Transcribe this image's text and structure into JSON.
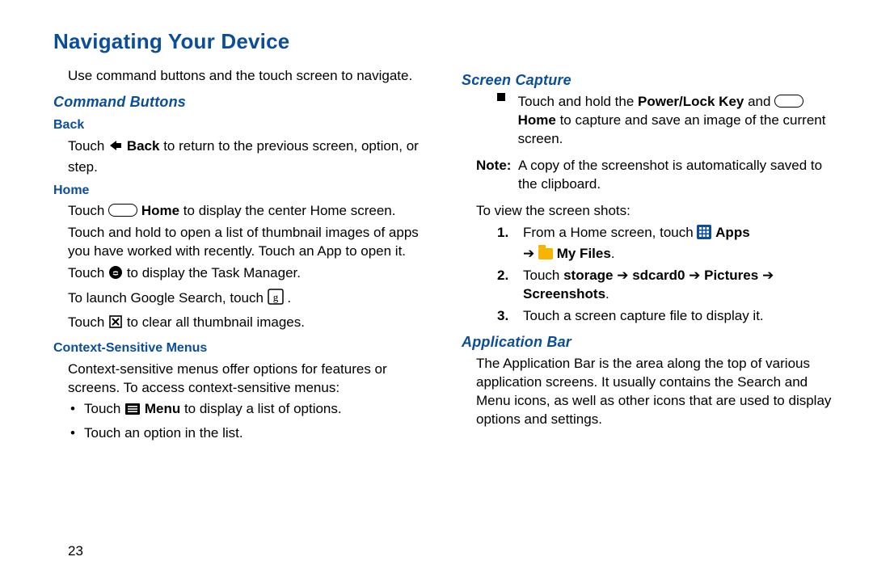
{
  "page_number": "23",
  "title": "Navigating Your Device",
  "intro": "Use command buttons and the touch screen to navigate.",
  "left": {
    "command_buttons": "Command Buttons",
    "back_h": "Back",
    "back_p1a": "Touch ",
    "back_label": "Back",
    "back_p1b": " to return to the previous screen, option, or step.",
    "home_h": "Home",
    "home_p1a": "Touch ",
    "home_label": "Home",
    "home_p1b": " to display the center Home screen.",
    "home_p2": "Touch and hold to open a list of thumbnail images of apps you have worked with recently. Touch an App to open it.",
    "home_p3a": "Touch ",
    "home_p3b": " to display the Task Manager.",
    "home_p4a": "To launch Google Search, touch ",
    "home_p4b": ".",
    "home_p5a": "Touch ",
    "home_p5b": " to clear all thumbnail images.",
    "ctx_h": "Context-Sensitive Menus",
    "ctx_p": "Context-sensitive menus offer options for features or screens. To access context-sensitive menus:",
    "ctx_b1a": "Touch ",
    "ctx_menu_label": "Menu",
    "ctx_b1b": " to display a list of options.",
    "ctx_b2": "Touch an option in the list."
  },
  "right": {
    "screen_capture_h": "Screen Capture",
    "sc_bullet_a": "Touch and hold the ",
    "sc_power": "Power/Lock Key",
    "sc_and": " and ",
    "sc_home": "Home",
    "sc_bullet_b": " to capture and save an image of the current screen.",
    "note_lbl": "Note:",
    "note_body": "A copy of the screenshot is automatically saved to the clipboard.",
    "view_intro": "To view the screen shots:",
    "s1a": "From a Home screen, touch ",
    "s1_apps": "Apps",
    "s1_arrow": "➔",
    "s1_myfiles": "My Files",
    "s1_end": ".",
    "s2a": "Touch ",
    "s2_storage": "storage",
    "s2_arrow": " ➔ ",
    "s2_sd": "sdcard0",
    "s2_pics": "Pictures",
    "s2_ss": "Screenshots",
    "s2_end": ".",
    "s3": "Touch a screen capture file to display it.",
    "appbar_h": "Application Bar",
    "appbar_p": "The Application Bar is the area along the top of various application screens. It usually contains the Search and Menu icons, as well as other icons that are used to display options and settings."
  }
}
